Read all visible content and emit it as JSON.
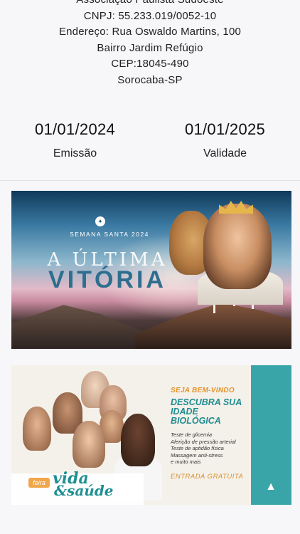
{
  "organization": {
    "name": "Associação Paulista Sudoeste",
    "cnpj": "CNPJ: 55.233.019/0052-10",
    "address": "Endereço: Rua Oswaldo Martins, 100",
    "district": "Bairro Jardim Refúgio",
    "cep": "CEP:18045-490",
    "city": "Sorocaba-SP"
  },
  "dates": {
    "issued": {
      "value": "01/01/2024",
      "label": "Emissão"
    },
    "valid": {
      "value": "01/01/2025",
      "label": "Validade"
    }
  },
  "banners": {
    "easter": {
      "kicker": "SEMANA SANTA 2024",
      "title_line1": "A ÚLTIMA",
      "title_line2": "VITÓRIA"
    },
    "health_fair": {
      "welcome": "SEJA BEM-VINDO",
      "headline_line1": "DESCUBRA SUA",
      "headline_line2": "IDADE BIOLÓGICA",
      "items": [
        "Teste de glicemia",
        "Aferição de pressão arterial",
        "Teste de aptidão física",
        "Massagem anti-stress",
        "e muito mais"
      ],
      "free_entry": "ENTRADA GRATUITA",
      "brand_tag": "feira",
      "brand_line1": "vida",
      "brand_line2": "&saúde"
    }
  }
}
